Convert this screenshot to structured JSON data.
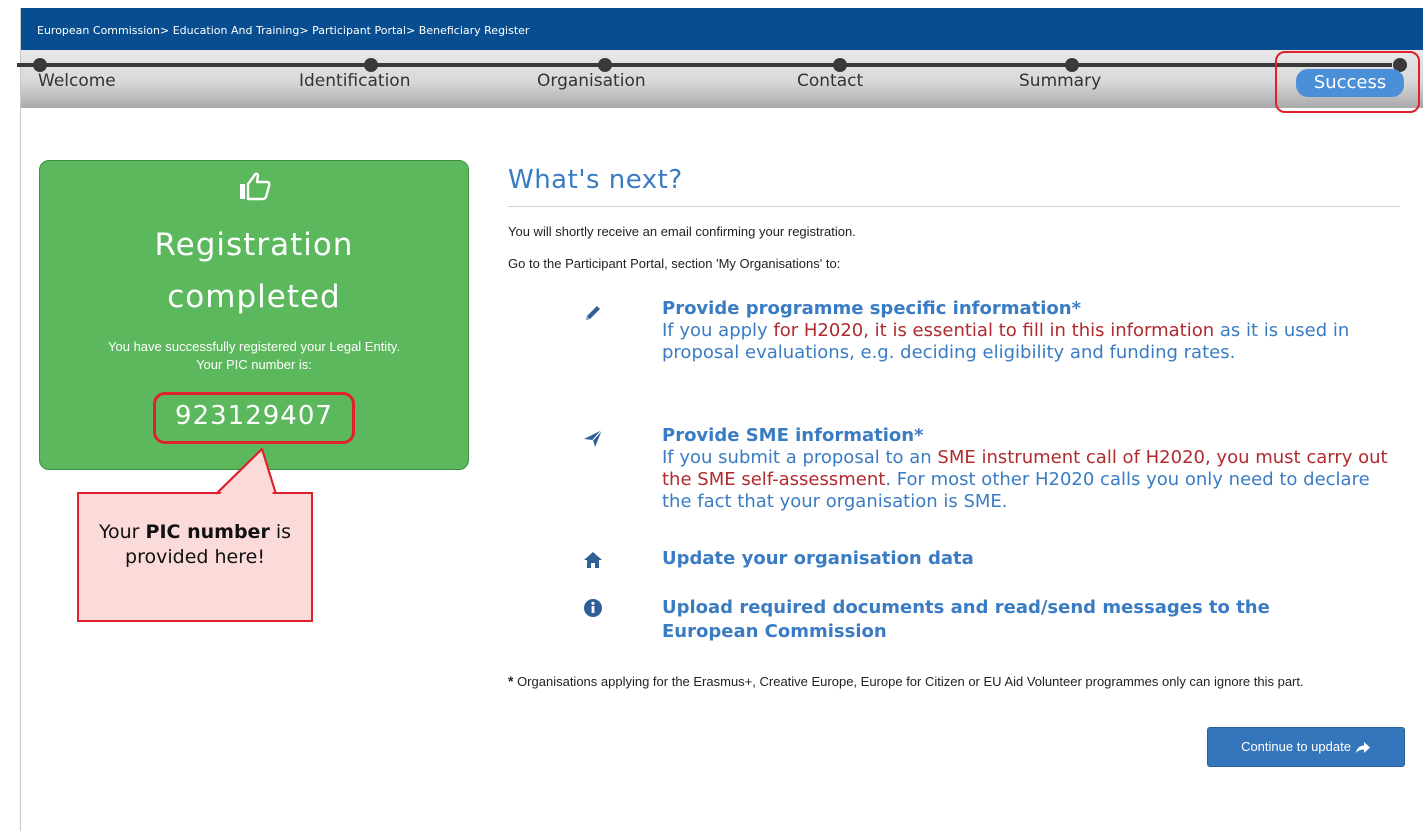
{
  "breadcrumb": {
    "items": [
      "European Commission",
      "Education And Training",
      "Participant Portal",
      "Beneficiary Register"
    ],
    "separator": ">"
  },
  "steps": [
    {
      "label": "Welcome"
    },
    {
      "label": "Identification"
    },
    {
      "label": "Organisation"
    },
    {
      "label": "Contact"
    },
    {
      "label": "Summary"
    },
    {
      "label": "Success"
    }
  ],
  "active_step": "Success",
  "card": {
    "icon": "thumbs-up-icon",
    "title_line1": "Registration",
    "title_line2": "completed",
    "message_line1": "You have successfully registered your Legal Entity.",
    "message_line2": "Your PIC number is:",
    "pic_number": "923129407"
  },
  "callout": {
    "text_before": "Your",
    "bold": "PIC number",
    "text_after": "is provided here!"
  },
  "whats_next": {
    "title": "What's next?",
    "line1": "You will shortly receive an email confirming your registration.",
    "line2": "Go to the Participant Portal, section 'My Organisations' to:",
    "items": [
      {
        "icon": "pencil-icon",
        "title": "Provide programme specific information",
        "title_mark": "*",
        "desc_a": "If you apply ",
        "desc_red": "for H2020, it is essential to fill in this information",
        "desc_b": " as it is used in proposal evaluations, e.g. deciding eligibility and funding rates."
      },
      {
        "icon": "paper-plane-icon",
        "title": "Provide SME information",
        "title_mark": "*",
        "desc_a": "If you submit a proposal to an ",
        "desc_red1": "SME instrument",
        "desc_b": " call of H2020, ",
        "desc_red2": "you must carry out the SME self-assessment",
        "desc_c": ". For most other H2020 calls you only need to declare the fact that your organisation is SME."
      },
      {
        "icon": "home-icon",
        "title": "Update your organisation data"
      },
      {
        "icon": "info-icon",
        "title_line1": "Upload required documents and read/send messages to the",
        "title_line2": "European Commission"
      }
    ]
  },
  "footnote": {
    "mark": "*",
    "text": " Organisations applying for the Erasmus+, Creative Europe, Europe for Citizen or EU Aid Volunteer programmes only can ignore this part."
  },
  "continue_button": {
    "label": "Continue to update",
    "icon": "share-arrow-icon"
  },
  "colors": {
    "header_blue": "#074d8f",
    "accent_blue": "#3a7cc3",
    "success_green": "#5cb85c",
    "highlight_red": "#e0202a",
    "warning_red_text": "#b02a2e"
  }
}
